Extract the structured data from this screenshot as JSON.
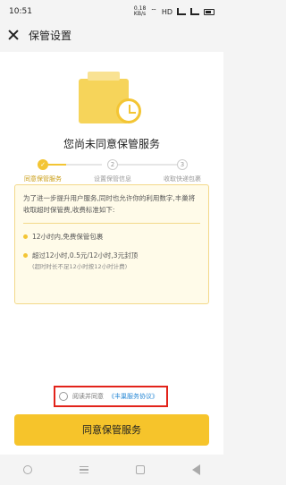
{
  "status_bar": {
    "time": "10:51",
    "net": "0.18\nKB/s",
    "hd": "HD"
  },
  "header": {
    "title": "保管设置"
  },
  "headline": "您尚未同意保管服务",
  "steps": [
    {
      "label": "同意保管服务",
      "number": "✓"
    },
    {
      "label": "设置保管信息",
      "number": "2"
    },
    {
      "label": "收取快递包裹",
      "number": "3"
    }
  ],
  "notice": {
    "intro": "为了进一步提升用户服务,同时也允许你的利用数字,丰巢将收取超时保管费,收费标准如下:",
    "item1": "12小时内,免费保管包裹",
    "item2": "超过12小时,0.5元/12小时,3元封顶",
    "item2_note": "(超时时长不足12小时按12小时计费)"
  },
  "agreement": {
    "prefix": "阅读并同意",
    "link": "《丰巢服务协议》"
  },
  "cta_label": "同意保管服务",
  "colors": {
    "accent": "#f6c42b",
    "link": "#2b8ad6",
    "highlight_border": "#e2231a"
  }
}
